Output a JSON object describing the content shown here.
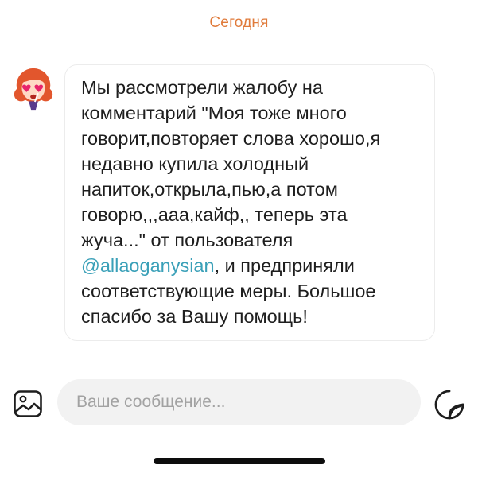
{
  "header": {
    "date_label": "Сегодня"
  },
  "message": {
    "sender_avatar_icon": "heart-eyes-girl-avatar-icon",
    "text_before_mention": "Мы рассмотрели жалобу на\nкомментарий \"Моя тоже много\nговорит,повторяет слова хорошо,я\nнедавно купила холодный\nнапиток,открыла,пью,а потом\nговорю,,,ааа,кайф,, теперь эта\nжуча...\" от пользователя\n",
    "mention": "@allaoganysian",
    "text_after_mention": ", и предприняли\nсоответствующие меры. Большое\nспасибо за Вашу помощь!"
  },
  "composer": {
    "gallery_icon": "image-icon",
    "input_placeholder": "Ваше сообщение...",
    "input_value": "",
    "sticker_icon": "sticker-icon"
  },
  "colors": {
    "accent": "#e07a3a",
    "mention": "#3aa0b8",
    "input_background": "#f2f2f2"
  }
}
